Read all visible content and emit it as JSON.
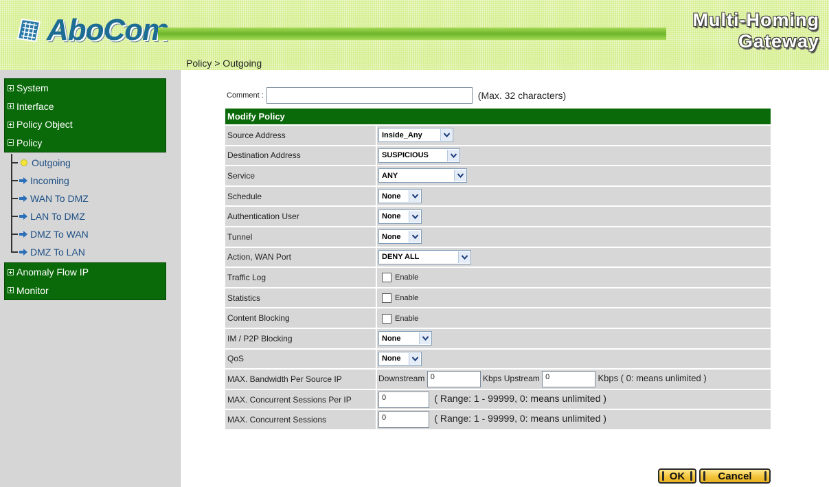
{
  "header": {
    "logo": "AboCom",
    "product_line1": "Multi-Homing",
    "product_line2": "Gateway",
    "breadcrumb": "Policy > Outgoing"
  },
  "sidebar": {
    "groups_top": [
      "System",
      "Interface",
      "Policy Object",
      "Policy"
    ],
    "sub_items": [
      "Outgoing",
      "Incoming",
      "WAN To DMZ",
      "LAN To DMZ",
      "DMZ To WAN",
      "DMZ To LAN"
    ],
    "groups_bottom": [
      "Anomaly Flow IP",
      "Monitor"
    ]
  },
  "comment": {
    "label": "Comment :",
    "value": "",
    "hint": "(Max. 32 characters)"
  },
  "table": {
    "header": "Modify Policy",
    "rows": {
      "source_address": {
        "label": "Source Address",
        "value": "Inside_Any"
      },
      "destination_address": {
        "label": "Destination Address",
        "value": "SUSPICIOUS"
      },
      "service": {
        "label": "Service",
        "value": "ANY"
      },
      "schedule": {
        "label": "Schedule",
        "value": "None"
      },
      "auth_user": {
        "label": "Authentication User",
        "value": "None"
      },
      "tunnel": {
        "label": "Tunnel",
        "value": "None"
      },
      "action": {
        "label": "Action, WAN Port",
        "value": "DENY ALL"
      },
      "traffic_log": {
        "label": "Traffic Log",
        "option": "Enable"
      },
      "statistics": {
        "label": "Statistics",
        "option": "Enable"
      },
      "content_blocking": {
        "label": "Content Blocking",
        "option": "Enable"
      },
      "im_p2p": {
        "label": "IM / P2P Blocking",
        "value": "None"
      },
      "qos": {
        "label": "QoS",
        "value": "None"
      },
      "max_bw": {
        "label": "MAX. Bandwidth Per Source IP",
        "downstream_label": "Downstream",
        "downstream_value": "0",
        "upstream_label": "Kbps Upstream",
        "upstream_value": "0",
        "suffix": "Kbps ( 0: means unlimited )"
      },
      "max_sess_ip": {
        "label": "MAX. Concurrent Sessions Per IP",
        "value": "0",
        "hint": "( Range: 1 - 99999, 0: means unlimited )"
      },
      "max_sess": {
        "label": "MAX. Concurrent Sessions",
        "value": "0",
        "hint": "( Range: 1 - 99999, 0: means unlimited )"
      }
    }
  },
  "buttons": {
    "ok": "OK",
    "cancel": "Cancel"
  },
  "colors": {
    "menu_green": "#0a6a0a",
    "header_green": "#d5ee8e",
    "sidebar_gray": "#d6d6d6",
    "button_yellow": "#f2c43a"
  }
}
